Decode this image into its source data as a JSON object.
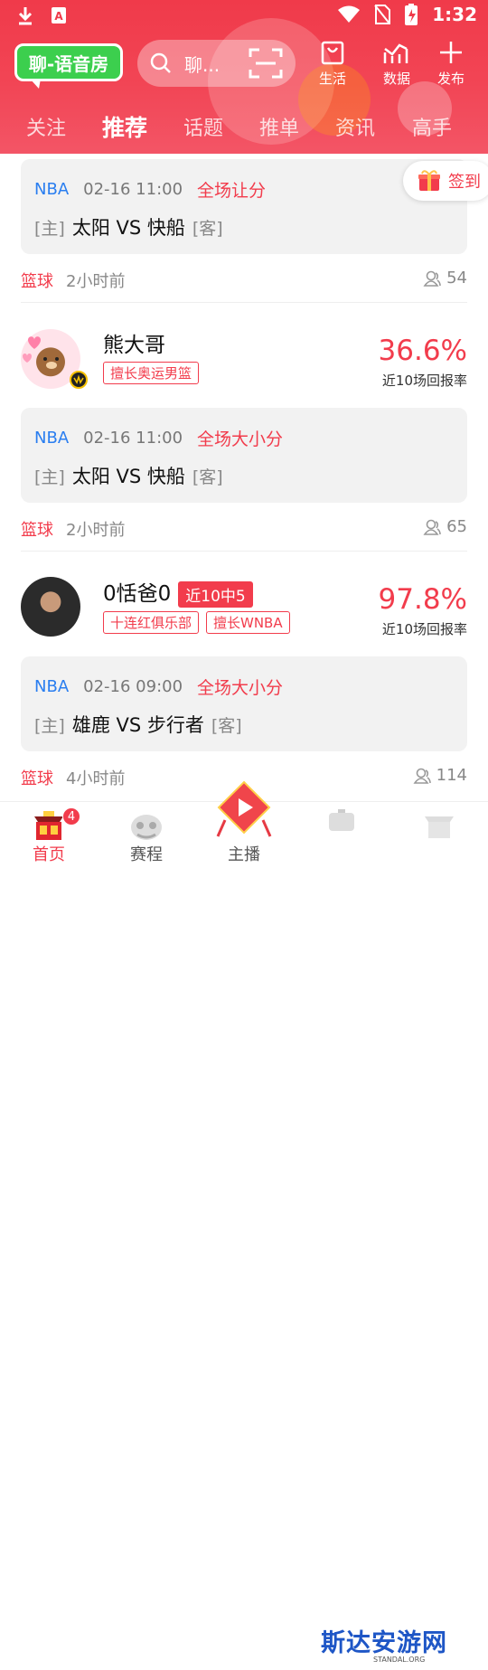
{
  "status_bar": {
    "time": "1:32"
  },
  "header": {
    "logo_text": "聊-语音房",
    "search_placeholder": "聊...",
    "actions": [
      {
        "label": "生活"
      },
      {
        "label": "数据"
      },
      {
        "label": "发布"
      }
    ],
    "tabs": [
      "关注",
      "推荐",
      "话题",
      "推单",
      "资讯",
      "高手"
    ],
    "active_tab": "推荐"
  },
  "signin_label": "签到",
  "feed": [
    {
      "match": {
        "league": "NBA",
        "time": "02-16 11:00",
        "type": "全场让分",
        "home_tag": "[主]",
        "teams": "太阳 VS 快船",
        "away_tag": "[客]"
      },
      "sport": "篮球",
      "ago": "2小时前",
      "views": "54"
    },
    {
      "user": {
        "name": "熊大哥",
        "tags": [
          "擅长奥运男篮"
        ],
        "rate": "36.6%",
        "rate_label": "近10场回报率"
      },
      "match": {
        "league": "NBA",
        "time": "02-16 11:00",
        "type": "全场大小分",
        "home_tag": "[主]",
        "teams": "太阳 VS 快船",
        "away_tag": "[客]"
      },
      "sport": "篮球",
      "ago": "2小时前",
      "views": "65"
    },
    {
      "user": {
        "name": "0恬爸0",
        "badge": "近10中5",
        "tags": [
          "十连红俱乐部",
          "擅长WNBA"
        ],
        "rate": "97.8%",
        "rate_label": "近10场回报率"
      },
      "match": {
        "league": "NBA",
        "time": "02-16 09:00",
        "type": "全场大小分",
        "home_tag": "[主]",
        "teams": "雄鹿 VS 步行者",
        "away_tag": "[客]"
      },
      "sport": "篮球",
      "ago": "4小时前",
      "views": "114"
    }
  ],
  "bottom_nav": [
    {
      "label": "首页",
      "badge": "4"
    },
    {
      "label": "赛程"
    },
    {
      "label": "主播"
    }
  ],
  "watermark": {
    "title": "斯达安游网",
    "sub": "STANDAL.ORG"
  },
  "colors": {
    "accent": "#f23c4c",
    "league_blue": "#2a7ef0",
    "logo_green": "#3ccf4e"
  }
}
